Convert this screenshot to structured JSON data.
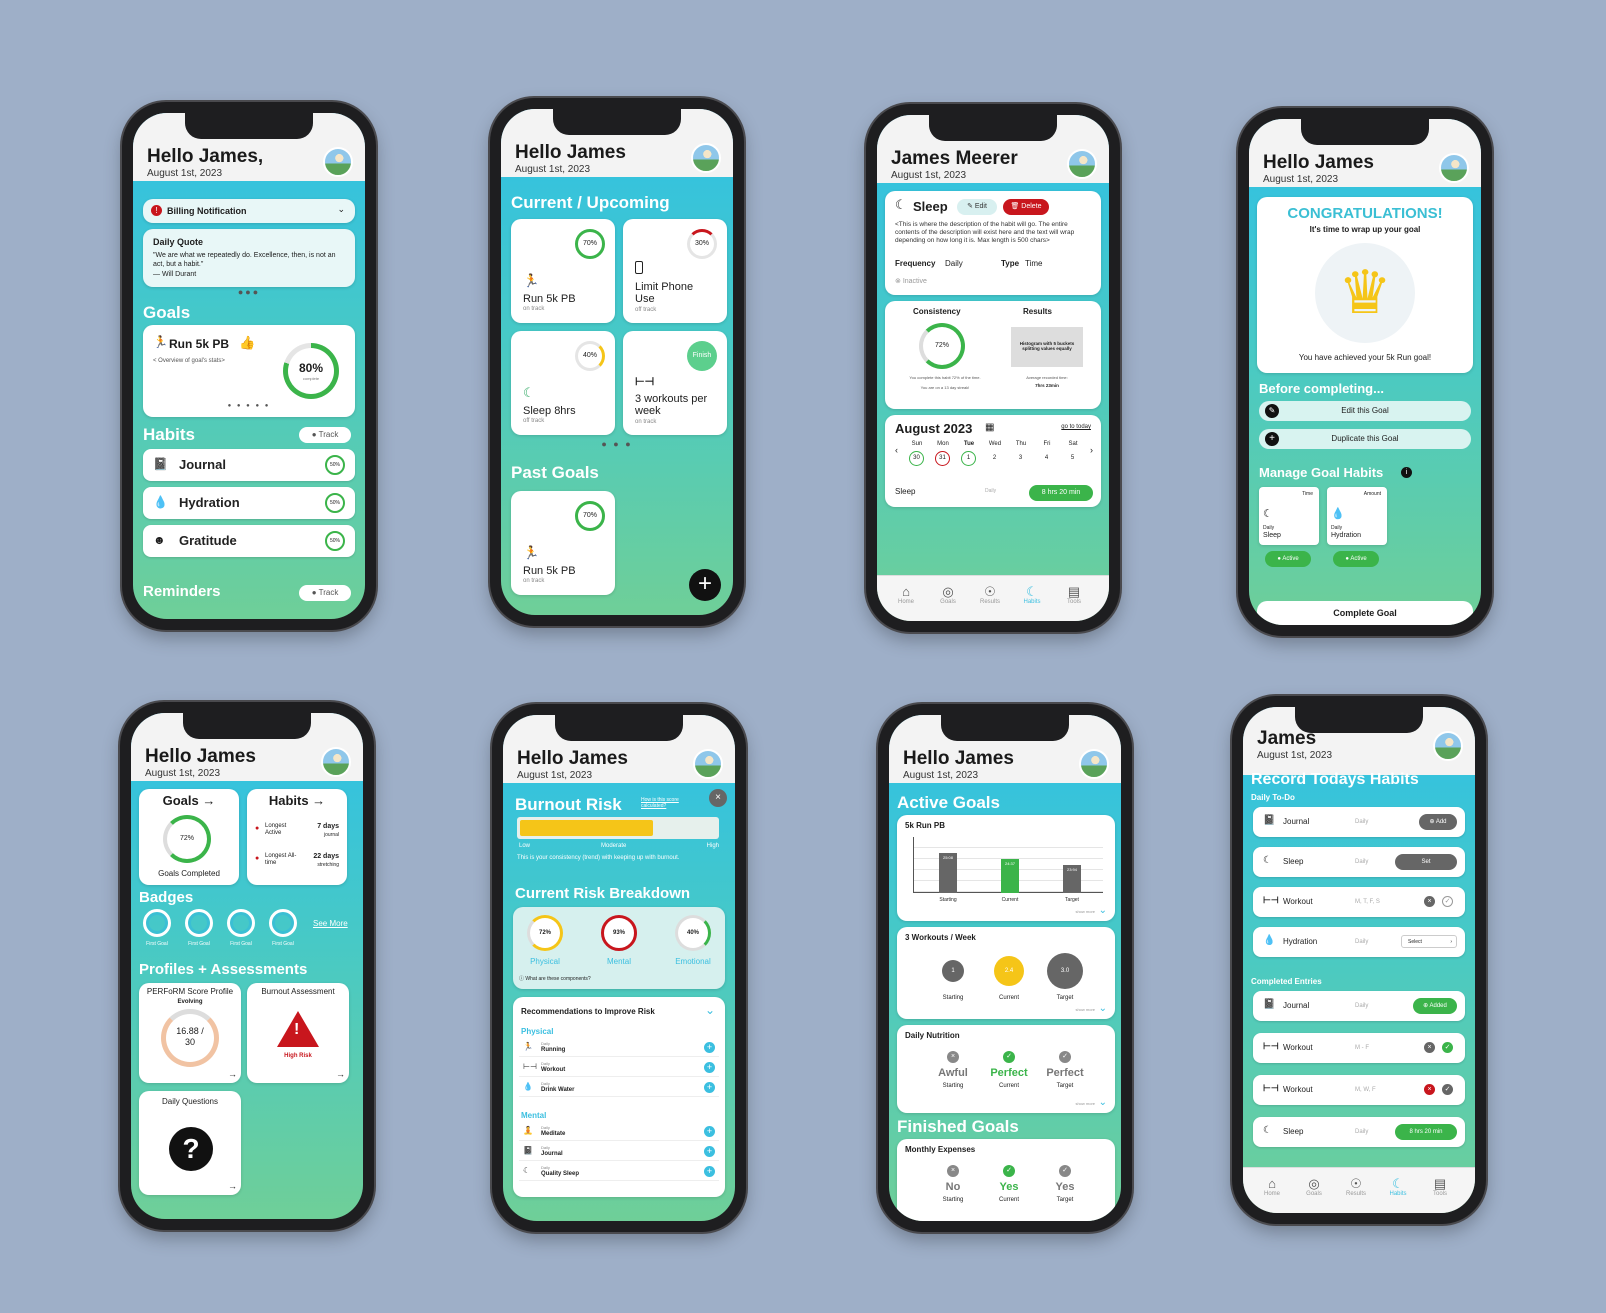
{
  "s1": {
    "title": "Hello James,",
    "date": "August 1st, 2023",
    "billing": "Billing Notification",
    "quote_title": "Daily Quote",
    "quote": "\"We are what we repeatedly do. Excellence, then, is not an act, but a habit.\"",
    "quote_author": "— Will Durant",
    "goals": "Goals",
    "goal_name": "Run 5k PB",
    "goal_sub": "< Overview of goal's stats>",
    "goal_pct": "80%",
    "goal_pct_sub": "complete",
    "goal_fill": 0.8,
    "habits": "Habits",
    "track": "Track",
    "h1": "Journal",
    "h2": "Hydration",
    "h3": "Gratitude",
    "hp": "50%",
    "reminders": "Reminders"
  },
  "s2": {
    "title": "Hello James",
    "date": "August 1st, 2023",
    "current": "Current / Upcoming",
    "c1": {
      "name": "Run 5k PB",
      "st": "on track",
      "pct": "70%"
    },
    "c2": {
      "name": "Limit Phone Use",
      "st": "off track",
      "pct": "30%"
    },
    "c3": {
      "name": "Sleep 8hrs",
      "st": "off track",
      "pct": "40%"
    },
    "c4": {
      "name": "3 workouts per week",
      "st": "on track",
      "btn": "Finish"
    },
    "past": "Past Goals",
    "p1": {
      "name": "Run 5k PB",
      "st": "on track",
      "pct": "70%"
    }
  },
  "s3": {
    "title": "James Meerer",
    "date": "August 1st, 2023",
    "habit": "Sleep",
    "edit": "Edit",
    "delete": "Delete",
    "desc": "<This is where the description of the habit will go. The entire contents of the description will exist here and the text will wrap depending on how long it is. Max length is 500 chars>",
    "freq_l": "Frequency",
    "freq": "Daily",
    "type_l": "Type",
    "type": "Time",
    "inactive": "Inactive",
    "consistency": "Consistency",
    "results": "Results",
    "cpct": "72%",
    "histo": "Histogram with 5 buckets splitting values equally",
    "cnote1": "You complete this habit 72% of the time.",
    "cnote2": "You are on a 13 day streak!",
    "avg_l": "Average recorded time:",
    "avg": "7hrs 23min",
    "month": "August 2023",
    "today": "go to today",
    "days": [
      "Sun",
      "Mon",
      "Tue",
      "Wed",
      "Thu",
      "Fri",
      "Sat"
    ],
    "nums": [
      "30",
      "31",
      "1",
      "2",
      "3",
      "4",
      "5"
    ],
    "sleep_l": "Sleep",
    "sleep_f": "Daily",
    "sleep_v": "8 hrs 20 min",
    "tabs": [
      "Home",
      "Goals",
      "Results",
      "Habits",
      "Tools"
    ]
  },
  "s4": {
    "title": "Hello James",
    "date": "August 1st, 2023",
    "congrats": "CONGRATULATIONS!",
    "wrap": "It's time to wrap up your goal",
    "achieved": "You have achieved your 5k Run goal!",
    "before": "Before completing...",
    "edit": "Edit this Goal",
    "dup": "Duplicate this Goal",
    "manage": "Manage Goal Habits",
    "hab1": {
      "type": "Time",
      "freq": "Daily",
      "name": "Sleep"
    },
    "hab2": {
      "type": "Amount",
      "freq": "Daily",
      "name": "Hydration"
    },
    "active": "Active",
    "complete": "Complete Goal"
  },
  "s5": {
    "title": "Hello James",
    "date": "August 1st, 2023",
    "goals": "Goals →",
    "gpct": "72%",
    "gdone": "Goals Completed",
    "habits": "Habits →",
    "la": "Longest Active",
    "la_v": "7 days",
    "la_s": "journal",
    "lt": "Longest All-time",
    "lt_v": "22 days",
    "lt_s": "stretching",
    "badges": "Badges",
    "badge": "First Goal",
    "seemore": "See More",
    "profiles": "Profiles + Assessments",
    "perf": "PERFoRM Score Profile",
    "evolving": "Evolving",
    "score": "16.88 / 30",
    "burnout": "Burnout Assessment",
    "highrisk": "High Risk",
    "dq": "Daily Questions"
  },
  "s6": {
    "title": "Hello James",
    "date": "August 1st, 2023",
    "burnout": "Burnout Risk",
    "calc": "How is this score calculated?",
    "low": "Low",
    "mod": "Moderate",
    "high": "High",
    "risk_level": 0.68,
    "cons": "This is your consistency (trend) with keeping up with burnout.",
    "breakdown": "Current Risk Breakdown",
    "phys": "Physical",
    "ment": "Mental",
    "emo": "Emotional",
    "pp": "72%",
    "mp": "93%",
    "ep": "40%",
    "comp": "What are these components?",
    "rec": "Recommendations to Improve Risk",
    "physical": "Physical",
    "mental": "Mental",
    "daily": "Daily",
    "r1": "Running",
    "r2": "Workout",
    "r3": "Drink Water",
    "r4": "Meditate",
    "r5": "Journal",
    "r6": "Quality Sleep"
  },
  "s7": {
    "title": "Hello James",
    "date": "August 1st, 2023",
    "active": "Active Goals",
    "g1": "5k Run PB",
    "bars": [
      "25:08",
      "24:37",
      "23:94"
    ],
    "bl": [
      "Starting",
      "Current",
      "Target"
    ],
    "showmore": "show more",
    "g2": "3 Workouts / Week",
    "w": [
      "1",
      "2.4",
      "3.0"
    ],
    "g3": "Daily Nutrition",
    "n": [
      "Awful",
      "Perfect",
      "Perfect"
    ],
    "finished": "Finished Goals",
    "g4": "Monthly Expenses",
    "e": [
      "No",
      "Yes",
      "Yes"
    ]
  },
  "s8": {
    "title": "James",
    "date": "August 1st, 2023",
    "record": "Record Todays Habits",
    "todo": "Daily To-Do",
    "t1": "Journal",
    "t2": "Sleep",
    "t3": "Workout",
    "t4": "Hydration",
    "daily": "Daily",
    "mtfs": "M, T, F, S",
    "add": "Add",
    "set": "Set",
    "select": "Select",
    "completed": "Completed Entries",
    "c1": "Journal",
    "c2": "Workout",
    "c3": "Workout",
    "c4": "Sleep",
    "added": "Added",
    "mf": "M - F",
    "mwf": "M, W, F",
    "sleep_v": "8 hrs 20 min",
    "tabs": [
      "Home",
      "Goals",
      "Results",
      "Habits",
      "Tools"
    ]
  },
  "colors": {
    "green": "#3bb44a",
    "red": "#c8161d",
    "yellow": "#f5c518",
    "cyan": "#2fc0e6"
  }
}
